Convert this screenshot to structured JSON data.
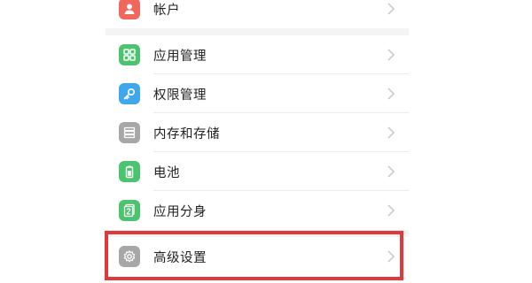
{
  "settings": {
    "items": [
      {
        "label": "帐户",
        "icon": "account-icon",
        "icon_color": "#f0675b"
      },
      {
        "label": "应用管理",
        "icon": "app-grid-icon",
        "icon_color": "#4cc36f"
      },
      {
        "label": "权限管理",
        "icon": "key-icon",
        "icon_color": "#3fa8ea"
      },
      {
        "label": "内存和存储",
        "icon": "storage-icon",
        "icon_color": "#a7a7a7"
      },
      {
        "label": "电池",
        "icon": "battery-icon",
        "icon_color": "#4cc36f"
      },
      {
        "label": "应用分身",
        "icon": "app-twin-icon",
        "icon_color": "#4cc36f"
      },
      {
        "label": "高级设置",
        "icon": "gear-icon",
        "icon_color": "#a7a7a7"
      }
    ]
  },
  "colors": {
    "highlight_border": "#e0393a",
    "chevron": "#c4c4c4",
    "section_gap": "#f4f4f4"
  }
}
